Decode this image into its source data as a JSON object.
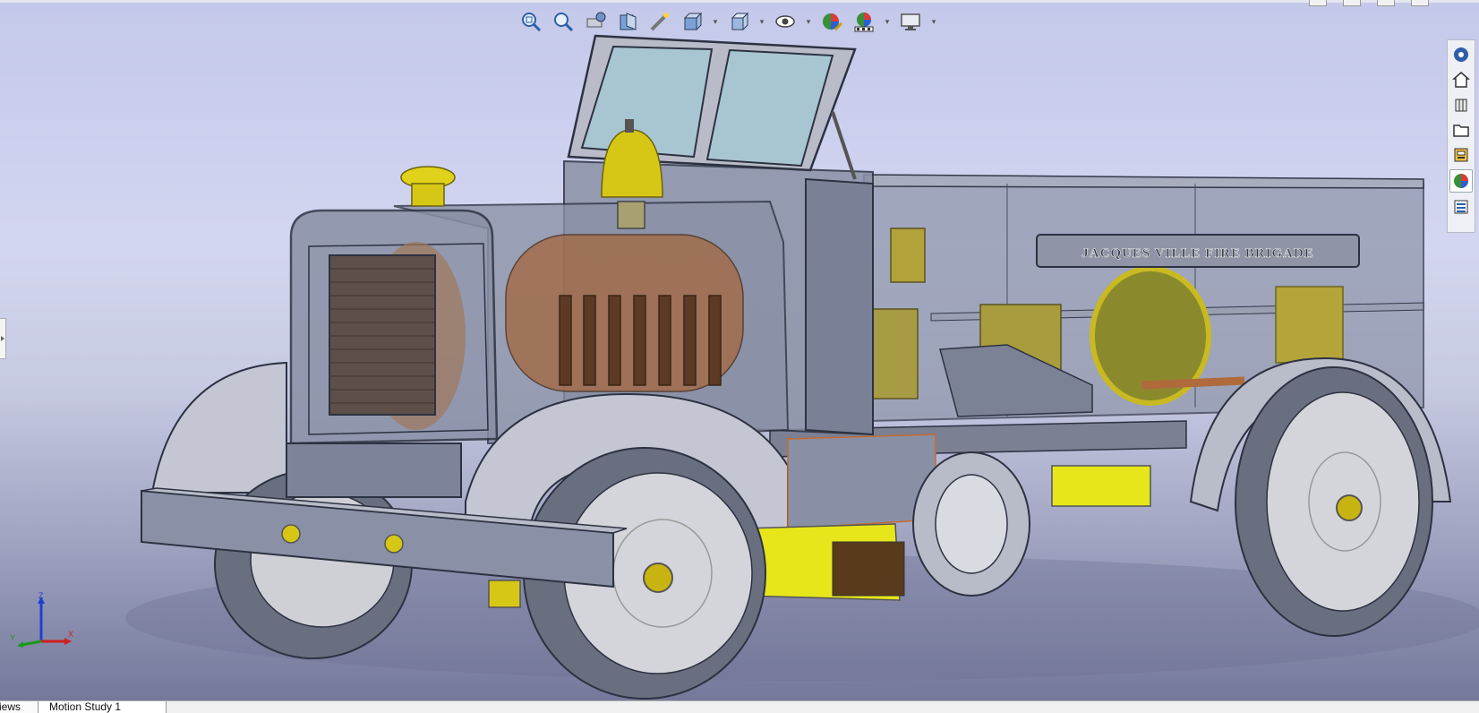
{
  "app": {
    "accent": "#1f5fbf"
  },
  "heads_up_toolbar": {
    "items": [
      {
        "id": "zoom-to-fit",
        "icon": "zoom-to-fit-icon"
      },
      {
        "id": "zoom-to-area",
        "icon": "zoom-to-area-icon"
      },
      {
        "id": "previous-view",
        "icon": "previous-view-icon"
      },
      {
        "id": "section-view",
        "icon": "section-view-icon"
      },
      {
        "id": "dynamic-annotation",
        "icon": "dynamic-annotation-icon"
      },
      {
        "id": "view-orientation",
        "icon": "view-orientation-icon",
        "dropdown": true
      },
      {
        "id": "display-style",
        "icon": "display-style-icon",
        "dropdown": true
      },
      {
        "id": "hide-show-items",
        "icon": "hide-show-eye-icon",
        "dropdown": true
      },
      {
        "id": "edit-appearance",
        "icon": "edit-appearance-icon"
      },
      {
        "id": "apply-scene",
        "icon": "apply-scene-icon",
        "dropdown": true
      },
      {
        "id": "view-settings",
        "icon": "view-settings-monitor-icon",
        "dropdown": true
      }
    ]
  },
  "task_pane": {
    "items": [
      {
        "id": "resources",
        "icon": "solidworks-resources-icon",
        "active": false
      },
      {
        "id": "home",
        "icon": "home-icon",
        "active": false
      },
      {
        "id": "design-library",
        "icon": "design-library-icon",
        "active": false
      },
      {
        "id": "file-explorer",
        "icon": "folder-icon",
        "active": false
      },
      {
        "id": "view-palette",
        "icon": "view-palette-icon",
        "active": false
      },
      {
        "id": "appearances",
        "icon": "appearances-globe-icon",
        "active": true
      },
      {
        "id": "custom-properties",
        "icon": "custom-properties-icon",
        "active": false
      }
    ]
  },
  "triad": {
    "z": "Z",
    "y": "Y",
    "x": "X"
  },
  "model": {
    "nameplate": "JACQUES VILLE FIRE BRIGADE",
    "colors": {
      "body_glass": "#8c93a8",
      "brass": "#c8b410",
      "yellow": "#e6e61a",
      "copper": "#b06a3c",
      "tyre": "#6a6f80",
      "rim": "#cfd0d6"
    }
  },
  "bottom_tabs": [
    {
      "label": "iews"
    },
    {
      "label": "Motion Study 1"
    }
  ]
}
